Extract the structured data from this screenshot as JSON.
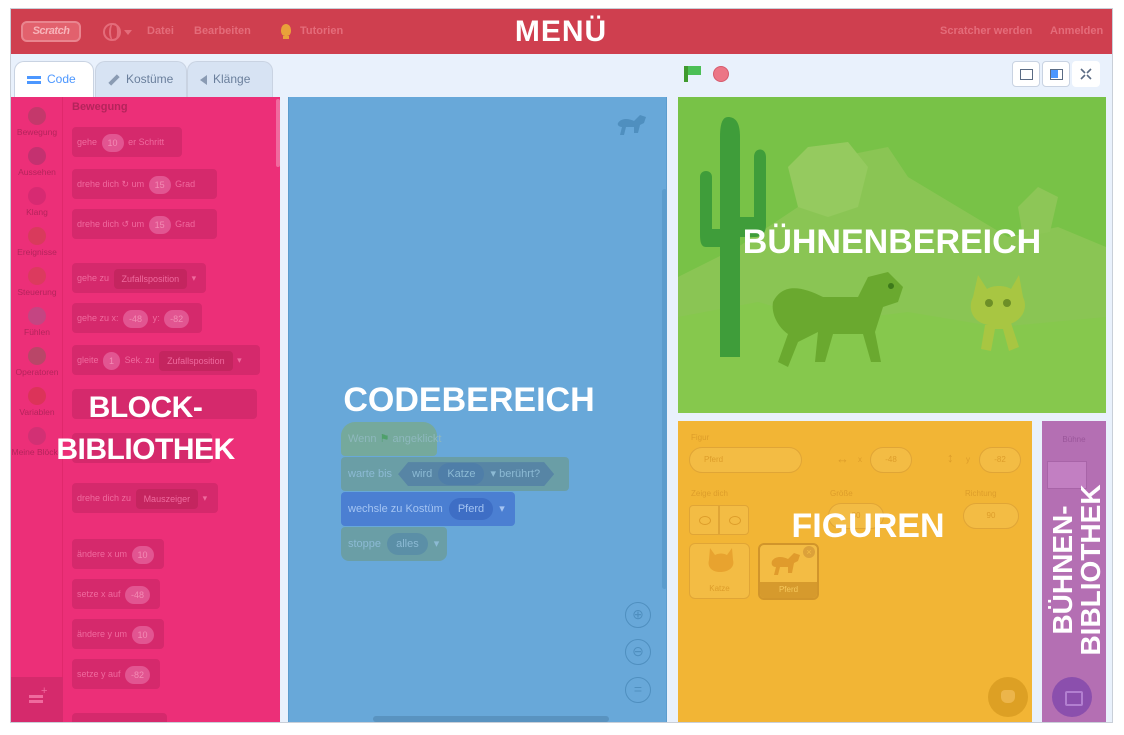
{
  "menu": {
    "logo": "Scratch",
    "file": "Datei",
    "edit": "Bearbeiten",
    "tutorials": "Tutorien",
    "join": "Scratcher werden",
    "signin": "Anmelden",
    "overlay_label": "MENÜ"
  },
  "tabs": [
    {
      "label": "Code"
    },
    {
      "label": "Kostüme"
    },
    {
      "label": "Klänge"
    }
  ],
  "categories": [
    {
      "label": "Bewegung",
      "color": "#c4386b"
    },
    {
      "label": "Aussehen",
      "color": "#c43170"
    },
    {
      "label": "Klang",
      "color": "#d72a72"
    },
    {
      "label": "Ereignisse",
      "color": "#d93a5c"
    },
    {
      "label": "Steuerung",
      "color": "#dc3a5e"
    },
    {
      "label": "Fühlen",
      "color": "#c44582"
    },
    {
      "label": "Operatoren",
      "color": "#b94668"
    },
    {
      "label": "Variablen",
      "color": "#dc3359"
    },
    {
      "label": "Meine Blöcke",
      "color": "#d23074"
    }
  ],
  "palette": {
    "title": "Bewegung",
    "blocks": {
      "move": {
        "a": "gehe",
        "v": "10",
        "b": "er Schritt"
      },
      "turn_right": {
        "a": "drehe dich",
        "b": "um",
        "v": "15",
        "c": "Grad"
      },
      "turn_left": {
        "a": "drehe dich",
        "b": "um",
        "v": "15",
        "c": "Grad"
      },
      "goto": {
        "a": "gehe zu",
        "dd": "Zufallsposition"
      },
      "goto_xy": {
        "a": "gehe zu x:",
        "x": "-48",
        "b": "y:",
        "y": "-82"
      },
      "glide": {
        "a": "gleite",
        "v": "1",
        "b": "Sek. zu",
        "dd": "Zufallsposition"
      },
      "point_towards": {
        "a": "drehe dich zu",
        "dd": "Mauszeiger"
      },
      "change_x": {
        "a": "ändere x um",
        "v": "10"
      },
      "set_x": {
        "a": "setze x auf",
        "v": "-48"
      },
      "change_y": {
        "a": "ändere y um",
        "v": "10"
      },
      "set_y": {
        "a": "setze y auf",
        "v": "-82"
      }
    },
    "overlay_label_line1": "BLOCK-",
    "overlay_label_line2": "BIBLIOTHEK"
  },
  "code": {
    "overlay_label": "CODEBEREICH",
    "script": {
      "when_flag": {
        "a": "Wenn",
        "b": "angeklickt"
      },
      "wait_until": {
        "a": "warte bis",
        "b": "wird",
        "dd": "Katze",
        "c": "berührt?"
      },
      "switch_costume": {
        "a": "wechsle zu Kostüm",
        "dd": "Pferd"
      },
      "stop": {
        "a": "stoppe",
        "dd": "alles"
      }
    },
    "zoom_reset": "="
  },
  "stage": {
    "overlay_label": "BÜHNENBEREICH"
  },
  "sprites": {
    "overlay_label": "FIGUREN",
    "sprite_label": "Figur",
    "sprite_name": "Pferd",
    "x_label": "x",
    "x_value": "-48",
    "y_label": "y",
    "y_value": "-82",
    "show_label": "Zeige dich",
    "size_label": "Größe",
    "size_value": "80",
    "direction_label": "Richtung",
    "direction_value": "90",
    "list": [
      {
        "name": "Katze"
      },
      {
        "name": "Pferd"
      }
    ]
  },
  "stage_library": {
    "title": "Bühne",
    "overlay_label_line1": "BÜHNEN-",
    "overlay_label_line2": "BIBLIOTHEK"
  }
}
